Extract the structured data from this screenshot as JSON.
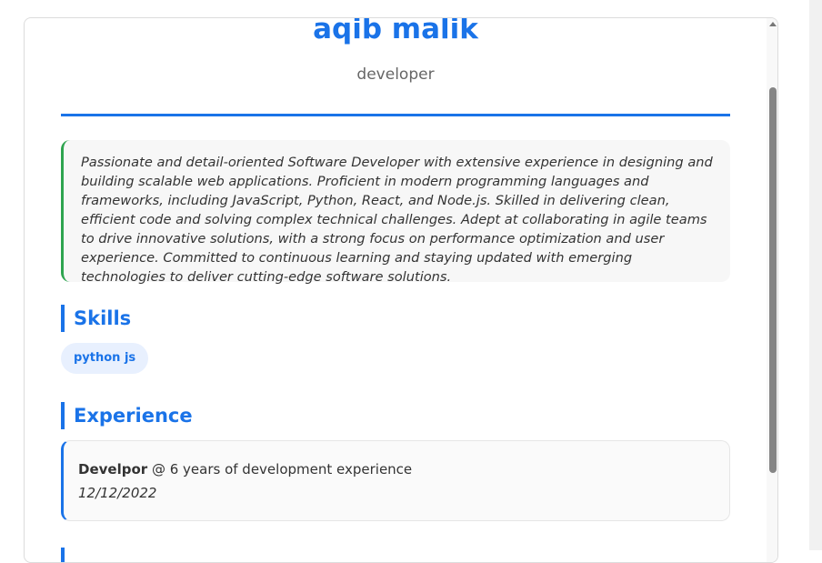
{
  "profile": {
    "name": "aqib malik",
    "role": "developer"
  },
  "summary": {
    "text": "Passionate and detail-oriented Software Developer with extensive experience in designing and building scalable web applications. Proficient in modern programming languages and frameworks, including JavaScript, Python, React, and Node.js. Skilled in delivering clean, efficient code and solving complex technical challenges. Adept at collaborating in agile teams to drive innovative solutions, with a strong focus on performance optimization and user experience. Committed to continuous learning and staying updated with emerging technologies to deliver cutting-edge software solutions."
  },
  "skills": {
    "title": "Skills",
    "items": [
      "python js"
    ]
  },
  "experience": {
    "title": "Experience",
    "items": [
      {
        "role": "Develpor",
        "separator": " @ ",
        "company": "6 years of development experience",
        "date": "12/12/2022"
      }
    ]
  },
  "colors": {
    "accent": "#1a73e8",
    "summary_border": "#2ea44f",
    "chip_bg": "#e8f0fe"
  }
}
